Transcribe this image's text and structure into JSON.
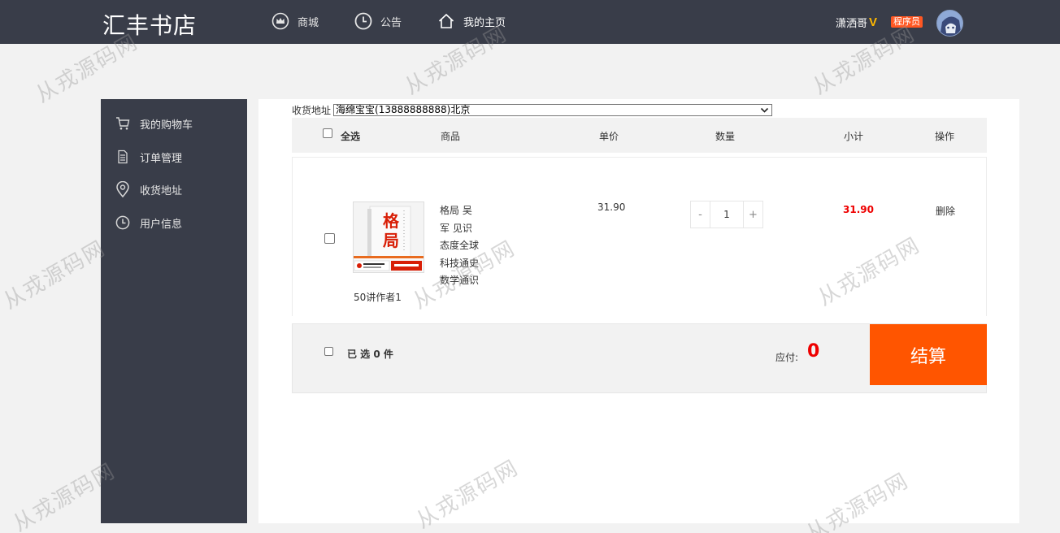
{
  "header": {
    "brand": "汇丰书店",
    "nav": [
      {
        "label": "商城",
        "icon": "crown-icon"
      },
      {
        "label": "公告",
        "icon": "clock-icon"
      },
      {
        "label": "我的主页",
        "icon": "home-icon"
      }
    ],
    "user": {
      "name": "潇洒哥",
      "vip_mark": "V",
      "role": "程序员"
    }
  },
  "watermark": "从戎源码网",
  "sidebar": {
    "items": [
      {
        "label": "我的购物车",
        "icon": "cart-icon"
      },
      {
        "label": "订单管理",
        "icon": "document-icon"
      },
      {
        "label": "收货地址",
        "icon": "location-icon"
      },
      {
        "label": "用户信息",
        "icon": "clock-icon"
      }
    ]
  },
  "cart": {
    "address_label": "收货地址",
    "address_value": "海绵宝宝(13888888888)北京",
    "columns": {
      "select_all": "全选",
      "product": "商品",
      "unit_price": "单价",
      "quantity": "数量",
      "subtotal": "小计",
      "action": "操作"
    },
    "item": {
      "title": "格局 吴军 见识态度全球科技通史数学通识",
      "title_lines": [
        "格局 吴",
        "军 见识",
        "态度全球",
        "科技通史",
        "数学通识"
      ],
      "subtitle": "50讲作者1",
      "price": "31.90",
      "minus": "-",
      "quantity": "1",
      "plus": "+",
      "subtotal": "31.90",
      "delete": "删除",
      "cover_text": "格局"
    },
    "footer": {
      "selected_prefix": "已 选",
      "selected_count": "0",
      "selected_suffix": "件",
      "pay_label": "应付:",
      "pay_amount": "0",
      "checkout": "结算"
    }
  },
  "colors": {
    "header_bg": "#393d49",
    "accent_orange": "#ff5500",
    "price_red": "#e00000",
    "vip_gold": "#ffb800",
    "role_badge": "#ff5722"
  }
}
